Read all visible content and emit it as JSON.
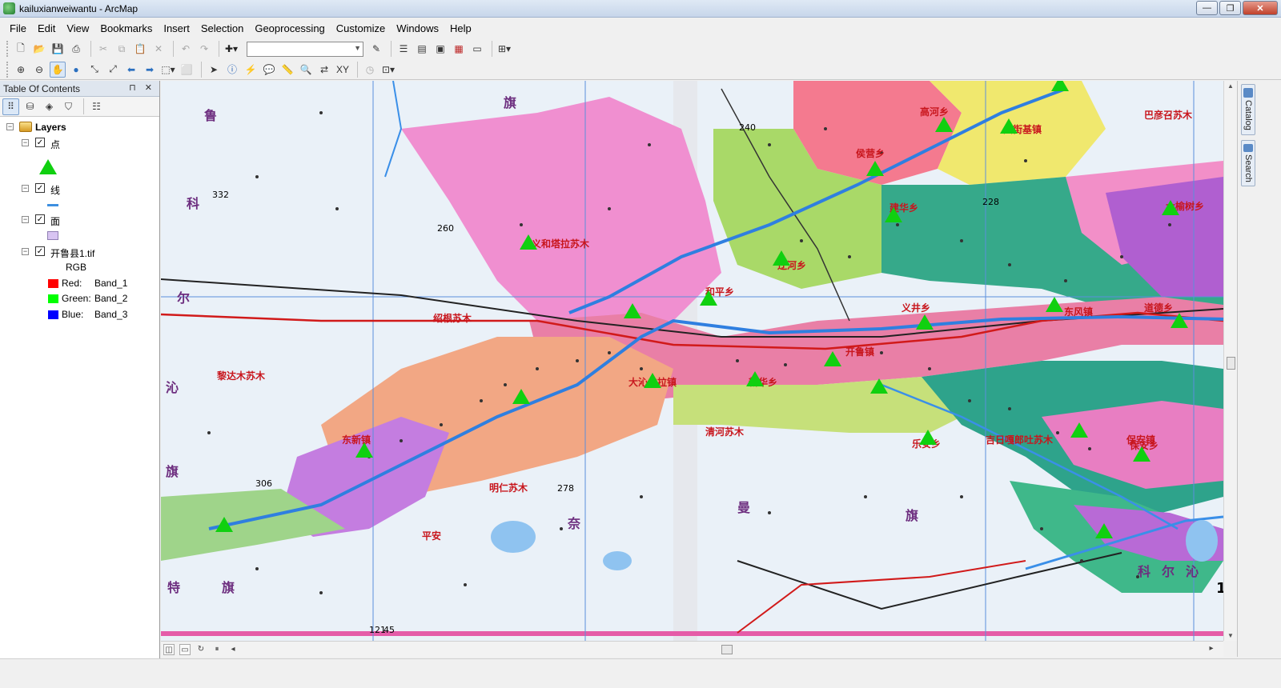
{
  "window": {
    "title": "kailuxianweiwantu - ArcMap",
    "minimize": "—",
    "restore": "❐",
    "close": "✕"
  },
  "menu": [
    "File",
    "Edit",
    "View",
    "Bookmarks",
    "Insert",
    "Selection",
    "Geoprocessing",
    "Customize",
    "Windows",
    "Help"
  ],
  "toolbar": {
    "scale_value": ""
  },
  "toc": {
    "title": "Table Of Contents",
    "header_buttons": "⊓ ✕",
    "root": "Layers",
    "layers": [
      {
        "name": "点",
        "checked": "✓",
        "symbol": "green-triangle"
      },
      {
        "name": "线",
        "checked": "✓",
        "symbol": "blue-line"
      },
      {
        "name": "面",
        "checked": "✓",
        "symbol": "lavender-fill"
      },
      {
        "name": "开鲁县1.tif",
        "checked": "✓",
        "symbol": "rgb-composite"
      }
    ],
    "rgb_label": "RGB",
    "bands": [
      {
        "channel": "Red:",
        "band": "Band_1",
        "color": "#ff0000"
      },
      {
        "channel": "Green:",
        "band": "Band_2",
        "color": "#00ff00"
      },
      {
        "channel": "Blue:",
        "band": "Band_3",
        "color": "#0000ff"
      }
    ]
  },
  "colors": {
    "point_symbol": "#10d010",
    "line_symbol": "#3d8fe0",
    "polygon_symbol": "#d8c4f2",
    "river": "#2f7fe0",
    "road": "#d11a1a"
  },
  "map_labels": {
    "towns": [
      "义和塔拉苏木",
      "绍根苏木",
      "黎达木苏木",
      "东新镇",
      "明仁苏木",
      "平安",
      "清河苏木",
      "开鲁镇",
      "义井乡",
      "道德乡",
      "东风镇",
      "乐安乡",
      "吉日嘎郎吐苏木",
      "保安乡",
      "巴彦召苏木",
      "高河乡",
      "大街基镇",
      "侯营乡",
      "辽河乡",
      "建华乡",
      "和平乡",
      "大榆树乡",
      "保安镇",
      "大沁他拉镇",
      "新华乡"
    ],
    "banners": [
      "旗",
      "鲁",
      "科",
      "尔",
      "沁",
      "旗",
      "奈",
      "曼",
      "旗",
      "科",
      "尔",
      "沁",
      "特",
      "旗"
    ],
    "numbers": [
      "260",
      "332",
      "306",
      "278",
      "240",
      "228",
      "121",
      "45",
      "1"
    ]
  },
  "right_dock": {
    "tabs": [
      "Catalog",
      "Search"
    ]
  }
}
